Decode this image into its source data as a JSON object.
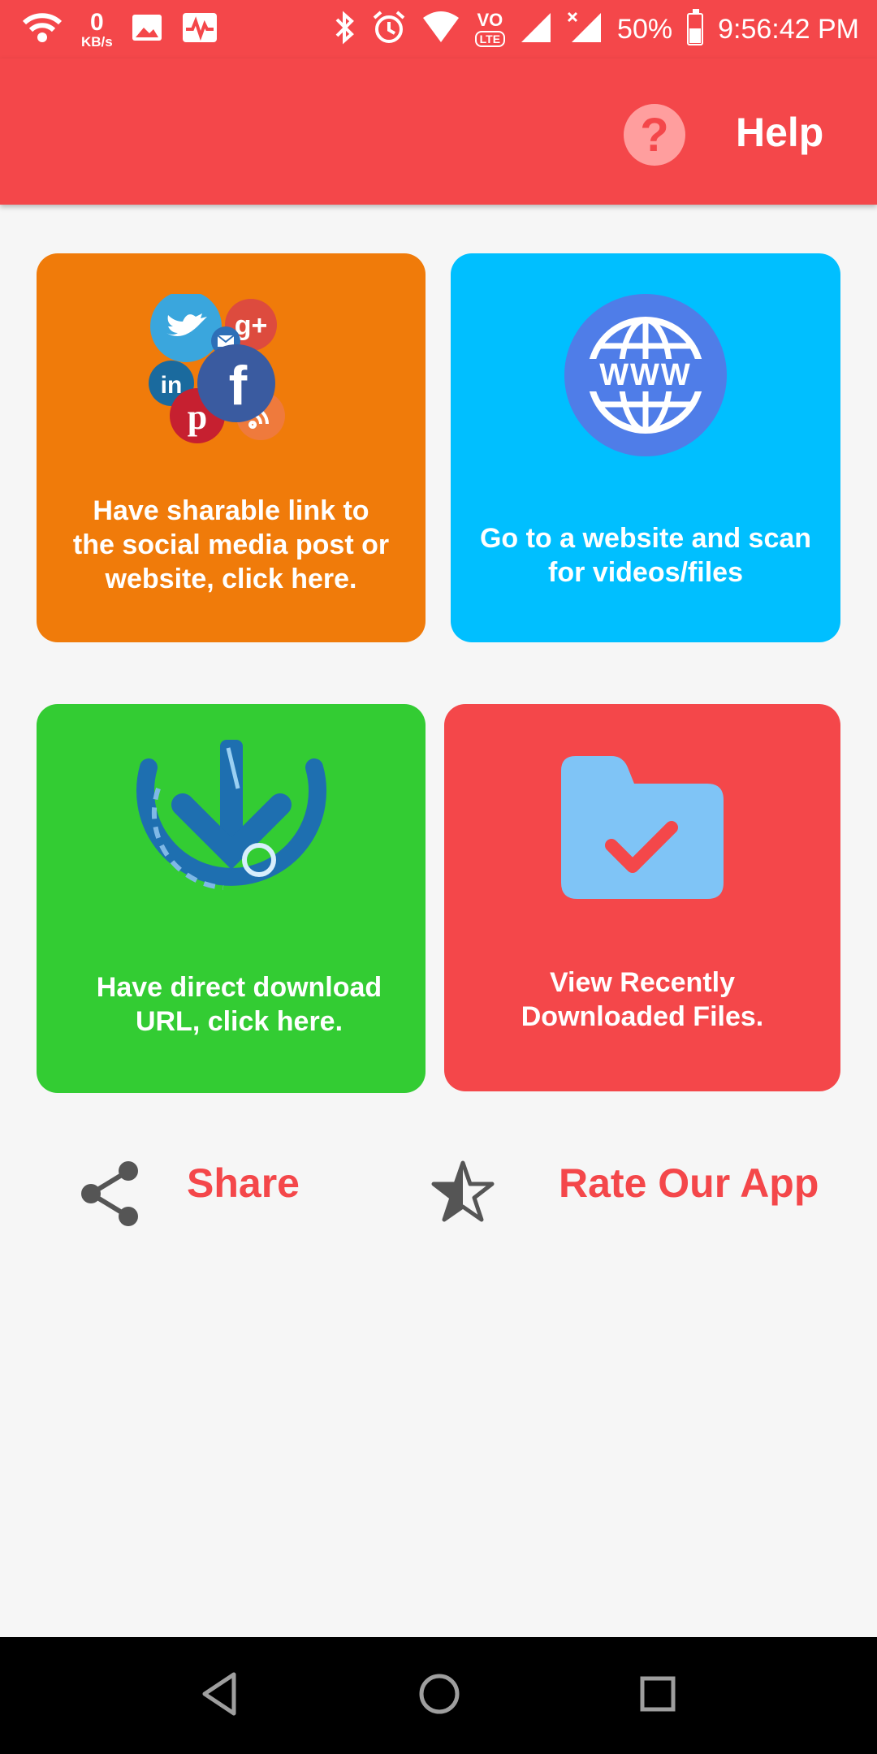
{
  "status_bar": {
    "speed_value": "0",
    "speed_unit": "KB/s",
    "lte_top": "VO",
    "lte_box": "LTE",
    "battery": "50%",
    "battery_level": 0.5,
    "time": "9:56:42 PM",
    "icons": [
      "wifi-icon",
      "image-icon",
      "activity-icon",
      "bluetooth-icon",
      "alarm-icon",
      "wifi-signal-icon",
      "signal-icon",
      "signal-no-data-icon",
      "battery-icon"
    ]
  },
  "app_bar": {
    "help_icon": "?",
    "help_label": "Help"
  },
  "cards": [
    {
      "text": "Have sharable link to\nthe social media post or\nwebsite, click here.",
      "icon": "social-media-icon",
      "color": "#f07b0a"
    },
    {
      "text": "Go to a website and scan\nfor videos/files",
      "icon": "www-globe-icon",
      "www": "WWW",
      "color": "#00bfff"
    },
    {
      "text": "Have direct download\nURL, click here.",
      "icon": "download-icon",
      "color": "#33cc33"
    },
    {
      "text": "View Recently\nDownloaded Files.",
      "icon": "folder-check-icon",
      "color": "#f4474a"
    }
  ],
  "actions": {
    "share_label": "Share",
    "rate_label": "Rate Our App",
    "accent": "#f4474a"
  },
  "nav_bar": {
    "icons": [
      "back-icon",
      "home-icon",
      "recents-icon"
    ]
  }
}
